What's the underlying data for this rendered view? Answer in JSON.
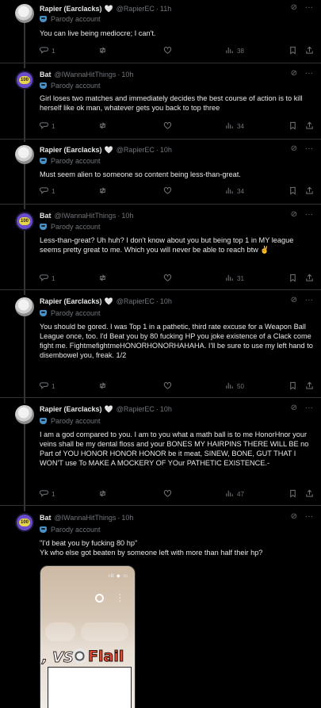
{
  "posts": [
    {
      "author": "Rapier (Earclacks)",
      "heart": "🤍",
      "handle": "@RapierEC",
      "time": "11h",
      "label": "Parody account",
      "text": "You can live being mediocre; I can't.",
      "replies": "1",
      "reposts": "",
      "likes": "",
      "views": "38"
    },
    {
      "author": "Bat",
      "heart": "",
      "handle": "@IWannaHitThings",
      "time": "10h",
      "label": "Parody account",
      "text": "Girl loses two matches and immediately decides the best course of action is to kill herself like ok man, whatever gets you back to top three",
      "replies": "1",
      "reposts": "",
      "likes": "",
      "views": "34"
    },
    {
      "author": "Rapier (Earclacks)",
      "heart": "🤍",
      "handle": "@RapierEC",
      "time": "10h",
      "label": "Parody account",
      "text": "Must seem alien to someone so content being less-than-great.",
      "replies": "1",
      "reposts": "",
      "likes": "",
      "views": "34"
    },
    {
      "author": "Bat",
      "heart": "",
      "handle": "@IWannaHitThings",
      "time": "10h",
      "label": "Parody account",
      "text": "Less-than-great? Uh huh? I don't know about you but being top 1 in MY league seems pretty great to me. Which you will never be able to reach btw ✌",
      "replies": "1",
      "reposts": "",
      "likes": "",
      "views": "31"
    },
    {
      "author": "Rapier (Earclacks)",
      "heart": "🤍",
      "handle": "@RapierEC",
      "time": "10h",
      "label": "Parody account",
      "text": "You should be gored. I was Top 1 in a pathetic, third rate excuse for a Weapon Ball League once, too. I'd Beat you by 80 fucking HP you joke existence of a Clack come fight me. FightmefightmeHONORHONORHAHAHA. I'll be sure to use my left hand to disembowel you, freak. 1/2",
      "replies": "1",
      "reposts": "",
      "likes": "",
      "views": "50"
    },
    {
      "author": "Rapier (Earclacks)",
      "heart": "🤍",
      "handle": "@RapierEC",
      "time": "10h",
      "label": "Parody account",
      "text": "I am a god compared to you. I am to you what a math ball is to me HonorHnor your veins shall be my dental floss and your BONES MY HAIRPINS THERE WILL BE no Part of YOU HONOR HONOR HONOR be it meat, SINEW, BONE, GUT THAT I WON'T use To MAKE A MOCKERY OF YOur PATHETIC EXISTENCE.-",
      "replies": "1",
      "reposts": "",
      "likes": "",
      "views": "47"
    },
    {
      "author": "Bat",
      "heart": "",
      "handle": "@IWannaHitThings",
      "time": "10h",
      "label": "Parody account",
      "text": "\"I'd beat you by fucking 80 hp\"\nYk who else got beaten by someone left with more than half their hp?",
      "replies": "",
      "reposts": "",
      "likes": "",
      "views": ""
    }
  ],
  "media": {
    "status_bar": "ıll ◆ ▭",
    "vs_text": ", VS",
    "weapon_text": "Flail"
  },
  "avatar_badge": "100",
  "colors": {
    "background": "#000000",
    "text": "#e7e9ea",
    "muted": "#71767b",
    "divider": "#2f3336",
    "parody_mask": "#4a90c2"
  }
}
